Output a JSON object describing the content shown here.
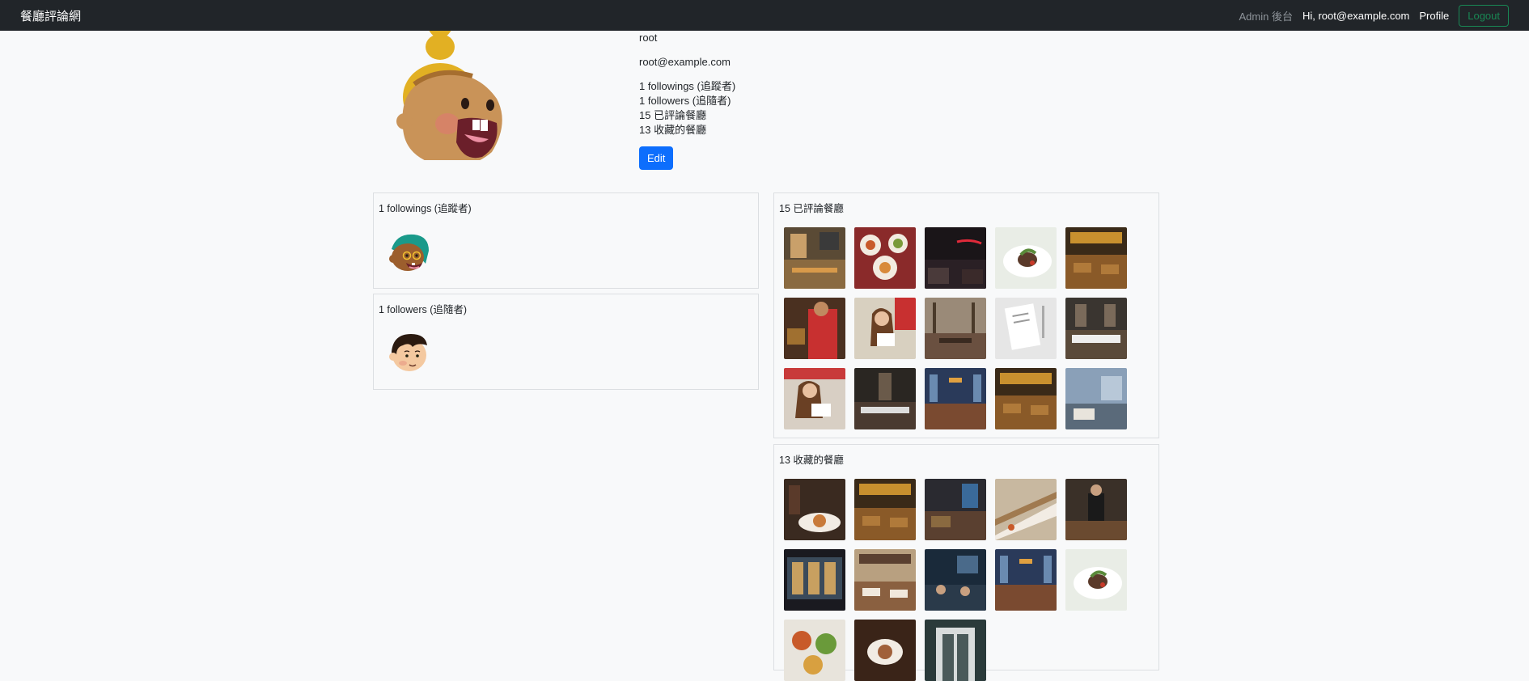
{
  "navbar": {
    "brand": "餐廳評論網",
    "admin_label": "Admin 後台",
    "greeting": "Hi, root@example.com",
    "profile_label": "Profile",
    "logout_label": "Logout"
  },
  "profile": {
    "name": "root",
    "email": "root@example.com",
    "followings_stat": "1 followings (追蹤者)",
    "followers_stat": "1 followers (追隨者)",
    "reviewed_stat": "15 已評論餐廳",
    "favorited_stat": "13 收藏的餐廳",
    "edit_label": "Edit"
  },
  "followings_card": {
    "title": "1 followings (追蹤者)"
  },
  "followers_card": {
    "title": "1 followers (追隨者)"
  },
  "reviewed_card": {
    "title": "15 已評論餐廳"
  },
  "favorited_card": {
    "title": "13 收藏的餐廳"
  },
  "colors": {
    "navbar_bg": "#212529",
    "primary": "#0d6efd",
    "logout": "#198754"
  }
}
